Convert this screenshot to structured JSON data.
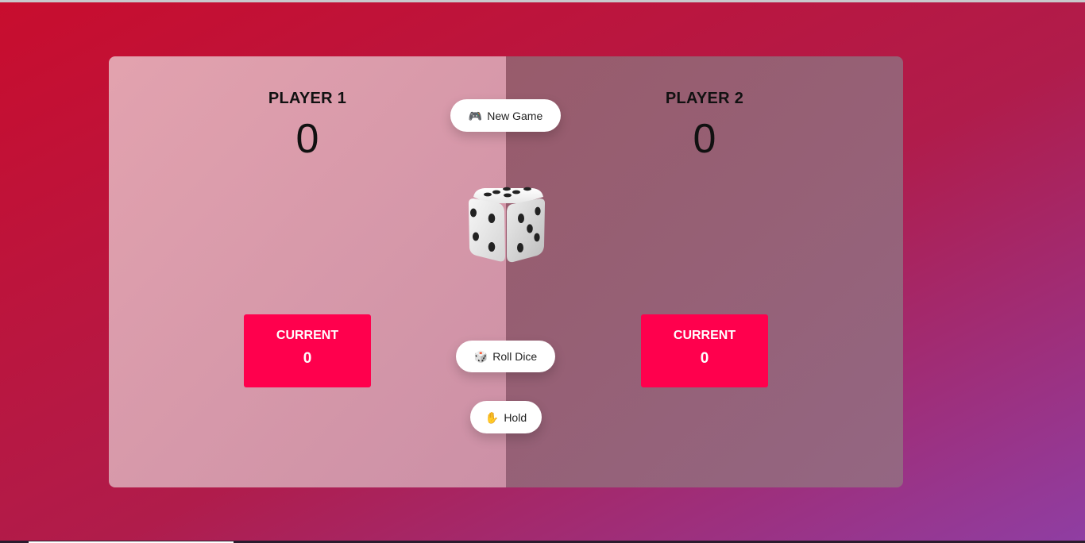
{
  "players": [
    {
      "name": "PLAYER 1",
      "score": "0",
      "current_label": "CURRENT",
      "current_score": "0",
      "active": true
    },
    {
      "name": "PLAYER 2",
      "score": "0",
      "current_label": "CURRENT",
      "current_score": "0",
      "active": false
    }
  ],
  "buttons": {
    "new_game": {
      "icon": "🎮",
      "label": "New Game"
    },
    "roll_dice": {
      "icon": "🎲",
      "label": "Roll Dice"
    },
    "hold": {
      "icon": "✋",
      "label": "Hold"
    }
  },
  "dice": {
    "value": 5,
    "icon": "dice-icon"
  },
  "colors": {
    "current_box": "#ff004d",
    "background_start": "#c80d2e",
    "background_end": "#8f3ea3"
  }
}
